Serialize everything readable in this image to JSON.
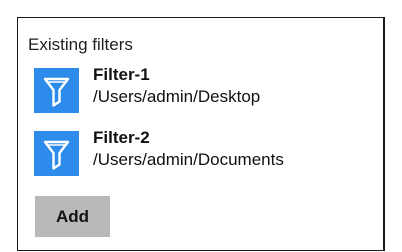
{
  "panel": {
    "title": "Existing filters"
  },
  "filters": [
    {
      "name": "Filter-1",
      "path": "/Users/admin/Desktop",
      "icon": "funnel-icon"
    },
    {
      "name": "Filter-2",
      "path": "/Users/admin/Documents",
      "icon": "funnel-icon"
    }
  ],
  "actions": {
    "add_label": "Add"
  },
  "colors": {
    "icon_bg": "#2d8ceb",
    "icon_fg": "#ffffff",
    "button_bg": "#b9b9b9",
    "border": "#1a1a1a"
  }
}
